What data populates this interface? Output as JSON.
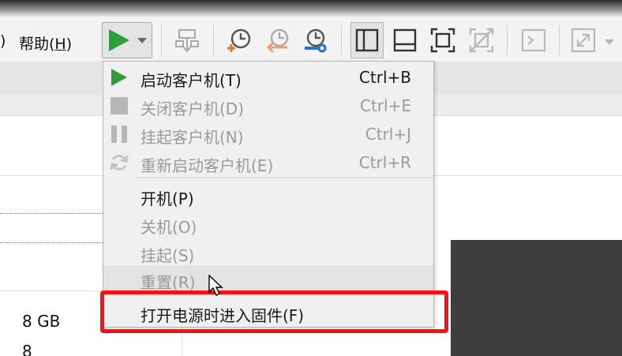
{
  "menubar": {
    "edge_paren": ")",
    "help_label": "帮助(",
    "help_key": "H",
    "help_close": ")"
  },
  "toolbar": {
    "colors": {
      "play": "#2e9d3a",
      "accent_orange": "#e8732a",
      "accent_blue": "#2b6fd1"
    }
  },
  "details": {
    "memory": "8 GB",
    "cpus": "8"
  },
  "machine_menu": {
    "items": [
      {
        "label": "启动客户机(T)",
        "shortcut": "Ctrl+B",
        "enabled": true,
        "icon": "play-icon"
      },
      {
        "label": "关闭客户机(D)",
        "shortcut": "Ctrl+E",
        "enabled": false,
        "icon": "stop-icon"
      },
      {
        "label": "挂起客户机(N)",
        "shortcut": "Ctrl+J",
        "enabled": false,
        "icon": "pause-icon"
      },
      {
        "label": "重新启动客户机(E)",
        "shortcut": "Ctrl+R",
        "enabled": false,
        "icon": "restart-icon"
      },
      {
        "label": "开机(P)",
        "shortcut": "",
        "enabled": true
      },
      {
        "label": "关机(O)",
        "shortcut": "",
        "enabled": false
      },
      {
        "label": "挂起(S)",
        "shortcut": "",
        "enabled": false
      },
      {
        "label": "重置(R)",
        "shortcut": "",
        "enabled": false,
        "hovered": true
      },
      {
        "label": "打开电源时进入固件(F)",
        "shortcut": "",
        "enabled": true,
        "highlighted": true
      }
    ]
  },
  "highlight_color": "#ff1010"
}
